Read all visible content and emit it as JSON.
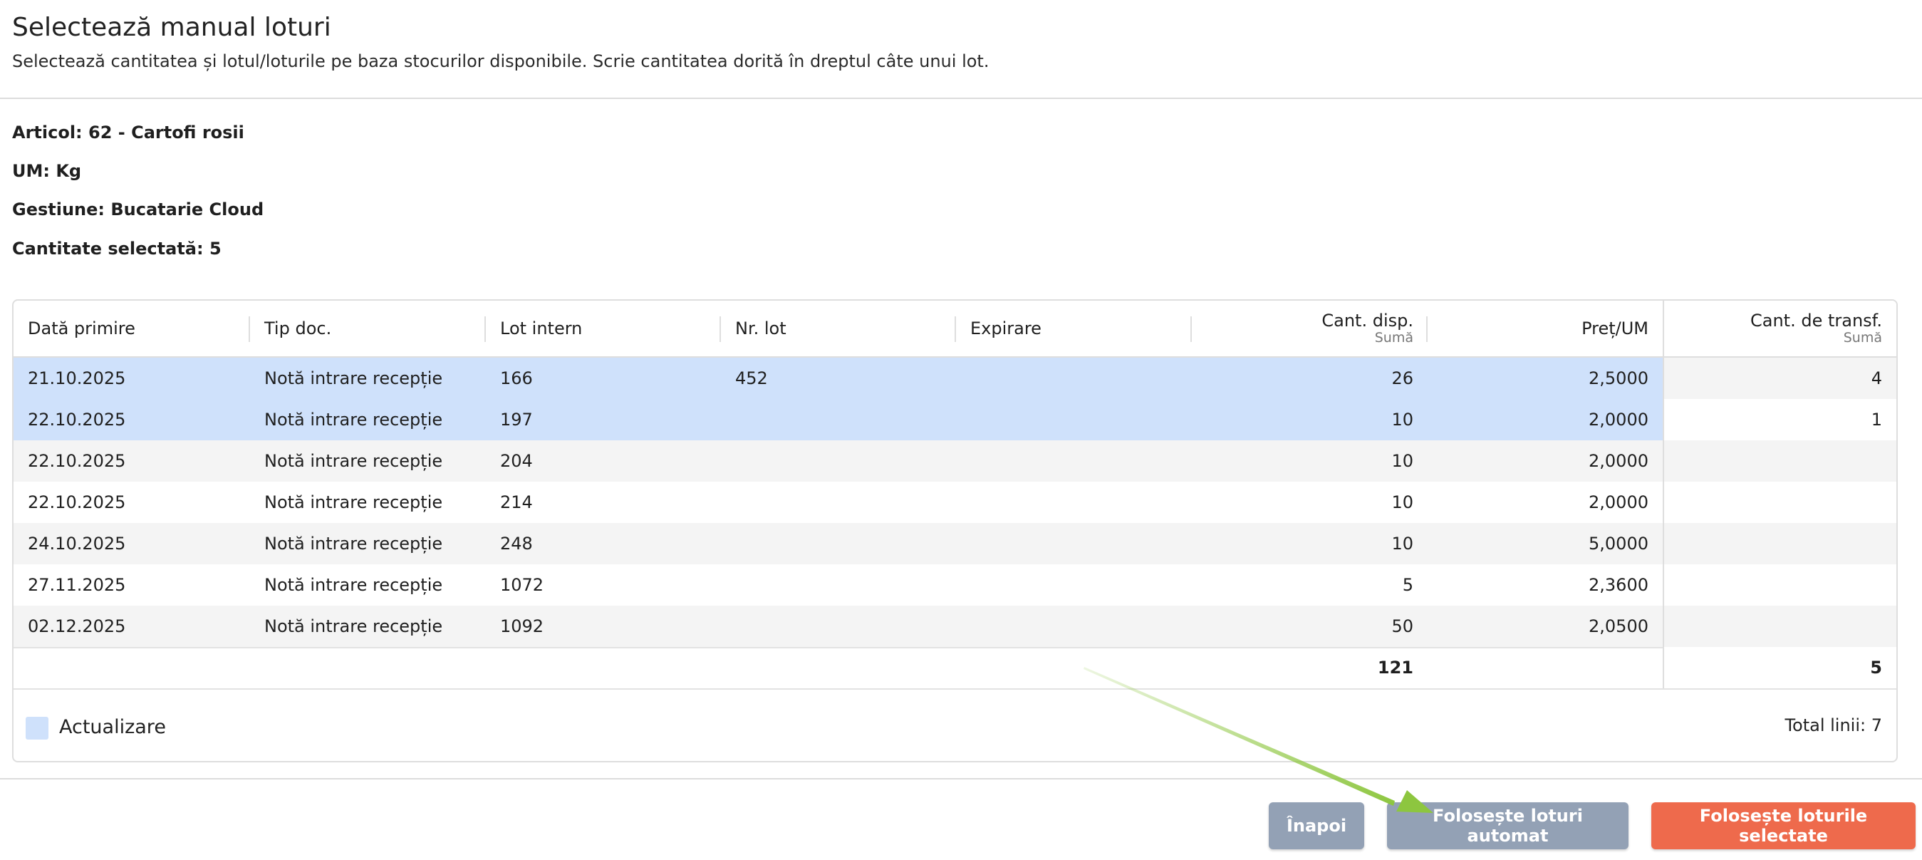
{
  "header": {
    "title": "Selectează manual loturi",
    "subtitle": "Selectează cantitatea și lotul/loturile pe baza stocurilor disponibile. Scrie cantitatea dorită în dreptul câte unui lot."
  },
  "info": {
    "article": "Articol: 62 - Cartofi rosii",
    "um": "UM: Kg",
    "gestiune": "Gestiune: Bucatarie Cloud",
    "selected_qty": "Cantitate selectată: 5"
  },
  "table": {
    "columns": {
      "date": "Dată primire",
      "doc_type": "Tip doc.",
      "internal_lot": "Lot intern",
      "lot_no": "Nr. lot",
      "expiry": "Expirare",
      "available": "Cant. disp.",
      "available_sub": "Sumă",
      "price": "Preț/UM",
      "transfer": "Cant. de transf.",
      "transfer_sub": "Sumă"
    },
    "rows": [
      {
        "date": "21.10.2025",
        "doc_type": "Notă intrare recepție",
        "internal_lot": "166",
        "lot_no": "452",
        "expiry": "",
        "available": "26",
        "price": "2,5000",
        "transfer": "4",
        "selected": true
      },
      {
        "date": "22.10.2025",
        "doc_type": "Notă intrare recepție",
        "internal_lot": "197",
        "lot_no": "",
        "expiry": "",
        "available": "10",
        "price": "2,0000",
        "transfer": "1",
        "selected": true
      },
      {
        "date": "22.10.2025",
        "doc_type": "Notă intrare recepție",
        "internal_lot": "204",
        "lot_no": "",
        "expiry": "",
        "available": "10",
        "price": "2,0000",
        "transfer": "",
        "selected": false
      },
      {
        "date": "22.10.2025",
        "doc_type": "Notă intrare recepție",
        "internal_lot": "214",
        "lot_no": "",
        "expiry": "",
        "available": "10",
        "price": "2,0000",
        "transfer": "",
        "selected": false
      },
      {
        "date": "24.10.2025",
        "doc_type": "Notă intrare recepție",
        "internal_lot": "248",
        "lot_no": "",
        "expiry": "",
        "available": "10",
        "price": "5,0000",
        "transfer": "",
        "selected": false
      },
      {
        "date": "27.11.2025",
        "doc_type": "Notă intrare recepție",
        "internal_lot": "1072",
        "lot_no": "",
        "expiry": "",
        "available": "5",
        "price": "2,3600",
        "transfer": "",
        "selected": false
      },
      {
        "date": "02.12.2025",
        "doc_type": "Notă intrare recepție",
        "internal_lot": "1092",
        "lot_no": "",
        "expiry": "",
        "available": "50",
        "price": "2,0500",
        "transfer": "",
        "selected": false
      }
    ],
    "totals": {
      "available": "121",
      "transfer": "5"
    },
    "legend_label": "Actualizare",
    "total_lines": "Total linii: 7"
  },
  "buttons": {
    "back": "Înapoi",
    "auto": "Folosește loturi automat",
    "use_selected": "Folosește loturile selectate"
  },
  "colors": {
    "selected_row": "#cfe1fb",
    "primary": "#ee6a4c",
    "secondary": "#93a1b5",
    "annotation_arrow": "#8dc63f"
  }
}
